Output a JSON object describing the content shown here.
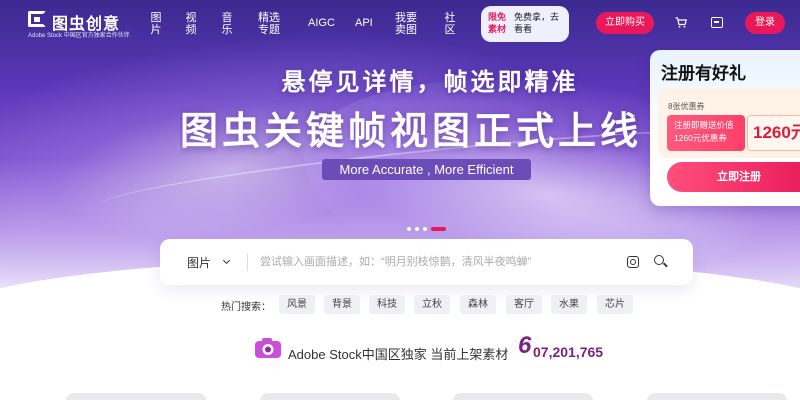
{
  "nav": {
    "logo_text": "图虫创意",
    "logo_sub": "Adobe Stock 中国区官方独家合作伙伴",
    "items": [
      {
        "label": "图片"
      },
      {
        "label": "视频"
      },
      {
        "label": "音乐"
      },
      {
        "label": "精选专题"
      },
      {
        "label": "AIGC"
      },
      {
        "label": "API"
      },
      {
        "label": "我要卖图"
      },
      {
        "label": "社区"
      }
    ],
    "promo_tag": "限免素材",
    "promo_text": "免费拿，去看看",
    "buy_label": "立即购买",
    "login_label": "登录",
    "cart_icon": "cart-icon",
    "message_icon": "message-icon"
  },
  "hero": {
    "headline": "悬停见详情，帧选即精准",
    "title": "图虫关键帧视图正式上线",
    "tagline": "More Accurate , More Efficient",
    "carousel_active": 4,
    "carousel_count": 4
  },
  "register_card": {
    "title": "注册有好礼",
    "coupon_count": "8张优惠券",
    "coupon_desc_1": "注册即赠送价值",
    "coupon_desc_2": "1260元优惠券",
    "amount": "1260元",
    "button_label": "立即注册"
  },
  "search": {
    "category": "图片",
    "placeholder": "尝试输入画面描述，如：“明月别枝惊鹊，清风半夜鸣蝉”",
    "value": ""
  },
  "hot_search": {
    "label": "热门搜索：",
    "tags": [
      "风景",
      "背景",
      "科技",
      "立秋",
      "森林",
      "客厅",
      "水果",
      "芯片"
    ]
  },
  "stock": {
    "text": "Adobe Stock中国区独家 当前上架素材",
    "count_first": "6",
    "count_rest": "07,201,765"
  },
  "colors": {
    "accent": "#e8185a",
    "stock_number": "#7a2283",
    "tagline_bg": "#6a4db6"
  }
}
